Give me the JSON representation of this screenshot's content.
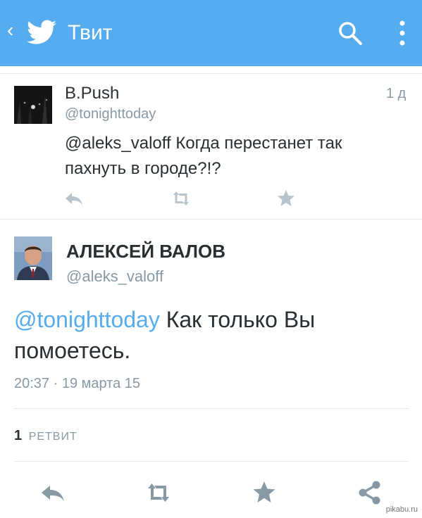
{
  "appbar": {
    "title": "Твит",
    "back_icon": "chevron-left-icon",
    "logo_icon": "twitter-bird-icon",
    "search_icon": "search-icon",
    "menu_icon": "more-vertical-icon",
    "color": "#55acee"
  },
  "tweet_reply": {
    "name": "B.Push",
    "handle": "@tonighttoday",
    "time": "1 д",
    "text": "@aleks_valoff Когда перестанет так пахнуть в городе?!?",
    "actions": [
      "reply-icon",
      "retweet-icon",
      "favorite-icon"
    ]
  },
  "tweet_main": {
    "name": "АЛЕКСЕЙ ВАЛОВ",
    "handle": "@aleks_valoff",
    "mention": "@tonighttoday",
    "text": "Как только Вы помоетесь.",
    "date": "20:37 · 19 марта 15",
    "retweet_count": "1",
    "retweet_label": "РЕТВИТ",
    "actions": [
      "reply-icon",
      "retweet-icon",
      "favorite-icon",
      "share-icon"
    ]
  },
  "watermark": "pikabu.ru",
  "colors": {
    "link": "#55acee",
    "secondary_text": "#8899a6",
    "icon_gray": "#b8c3cc",
    "icon_dark": "#8899a6"
  }
}
